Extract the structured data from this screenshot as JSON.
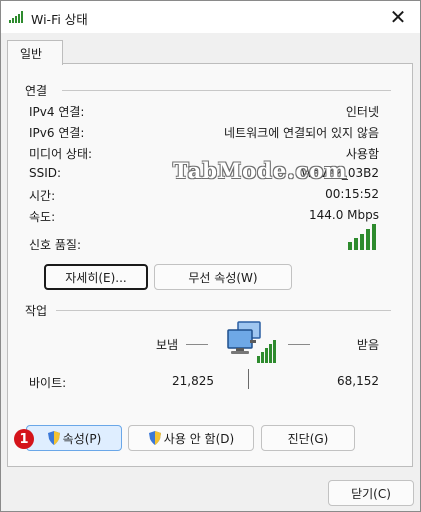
{
  "window": {
    "title": "Wi-Fi 상태",
    "close_label": "✕"
  },
  "tabs": {
    "general": "일반"
  },
  "connection": {
    "title": "연결",
    "rows": [
      {
        "label": "IPv4 연결:",
        "value": "인터넷"
      },
      {
        "label": "IPv6 연결:",
        "value": "네트워크에 연결되어 있지 않음"
      },
      {
        "label": "미디어 상태:",
        "value": "사용함"
      },
      {
        "label": "SSID:",
        "value": "Wave2_03B2"
      },
      {
        "label": "시간:",
        "value": "00:15:52"
      },
      {
        "label": "속도:",
        "value": "144.0 Mbps"
      }
    ],
    "signal_label": "신호 품질:",
    "signal_bars": 5,
    "details_button": "자세히(E)...",
    "wireless_button": "무선 속성(W)"
  },
  "activity": {
    "title": "작업",
    "sent_label": "보냄",
    "received_label": "받음",
    "bytes_label": "바이트:",
    "bytes_sent": "21,825",
    "bytes_received": "68,152"
  },
  "buttons": {
    "properties": "속성(P)",
    "disable": "사용 안 함(D)",
    "diagnose": "진단(G)",
    "close": "닫기(C)"
  },
  "watermark": "TabMode.com",
  "callout": "1",
  "colors": {
    "signal": "#2e8b2e",
    "highlight": "#dfeeff",
    "callout": "#d4141b"
  }
}
